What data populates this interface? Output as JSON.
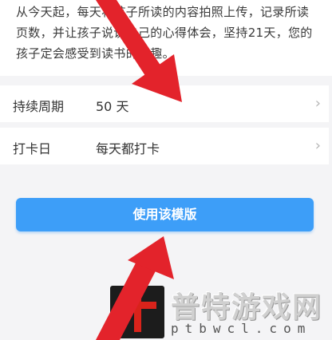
{
  "description": {
    "text": "从今天起，每天将孩子所读的内容拍照上传，记录所读页数，并让孩子说说自己的心得体会，坚持21天，您的孩子定会感受到读书的乐趣。"
  },
  "settings": [
    {
      "label": "持续周期",
      "value": "50 天",
      "chevron": "›"
    },
    {
      "label": "打卡日",
      "value": "每天都打卡",
      "chevron": "›"
    }
  ],
  "actions": {
    "use_template_label": "使用该模版"
  },
  "watermark": {
    "name": "普特游戏网",
    "url": "ptbwcl.com"
  },
  "colors": {
    "accent": "#3d9ef8",
    "annotation_arrow": "#e3232b",
    "background": "#f4f4f6"
  },
  "icons": {
    "row_chevron": "chevron-right-icon",
    "annotation": "red-arrow-icon"
  }
}
